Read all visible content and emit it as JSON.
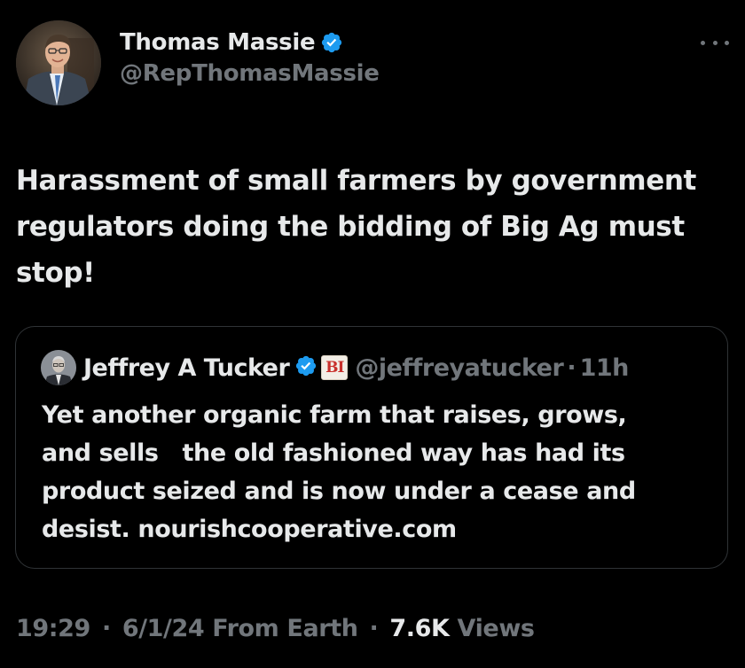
{
  "post": {
    "author": {
      "display_name": "Thomas Massie",
      "handle": "@RepThomasMassie",
      "verified_color": "#1d9bf0"
    },
    "more_icon": "more-horizontal-icon",
    "text": "Harassment of small farmers by government regulators doing the bidding of Big Ag must stop!",
    "quote": {
      "author": {
        "display_name": "Jeffrey A Tucker",
        "handle": "@jeffreyatucker",
        "affiliate_badge": "BI"
      },
      "separator": "·",
      "time": "11h",
      "text_line1": "Yet another organic farm that raises, grows,",
      "text_line2": "and sells   the old fashioned way has had its",
      "text_line3": "product seized and is now under a cease and",
      "text_line4": "desist. nourishcooperative.com"
    },
    "meta": {
      "time": "19:29",
      "date": "6/1/24",
      "location": "From Earth",
      "separator": "·",
      "views_count": "7.6K",
      "views_label": "Views"
    }
  },
  "colors": {
    "background": "#000000",
    "text_primary": "#e7e9ea",
    "text_secondary": "#71767b",
    "border": "#2f3336",
    "verified_blue": "#1d9bf0"
  }
}
